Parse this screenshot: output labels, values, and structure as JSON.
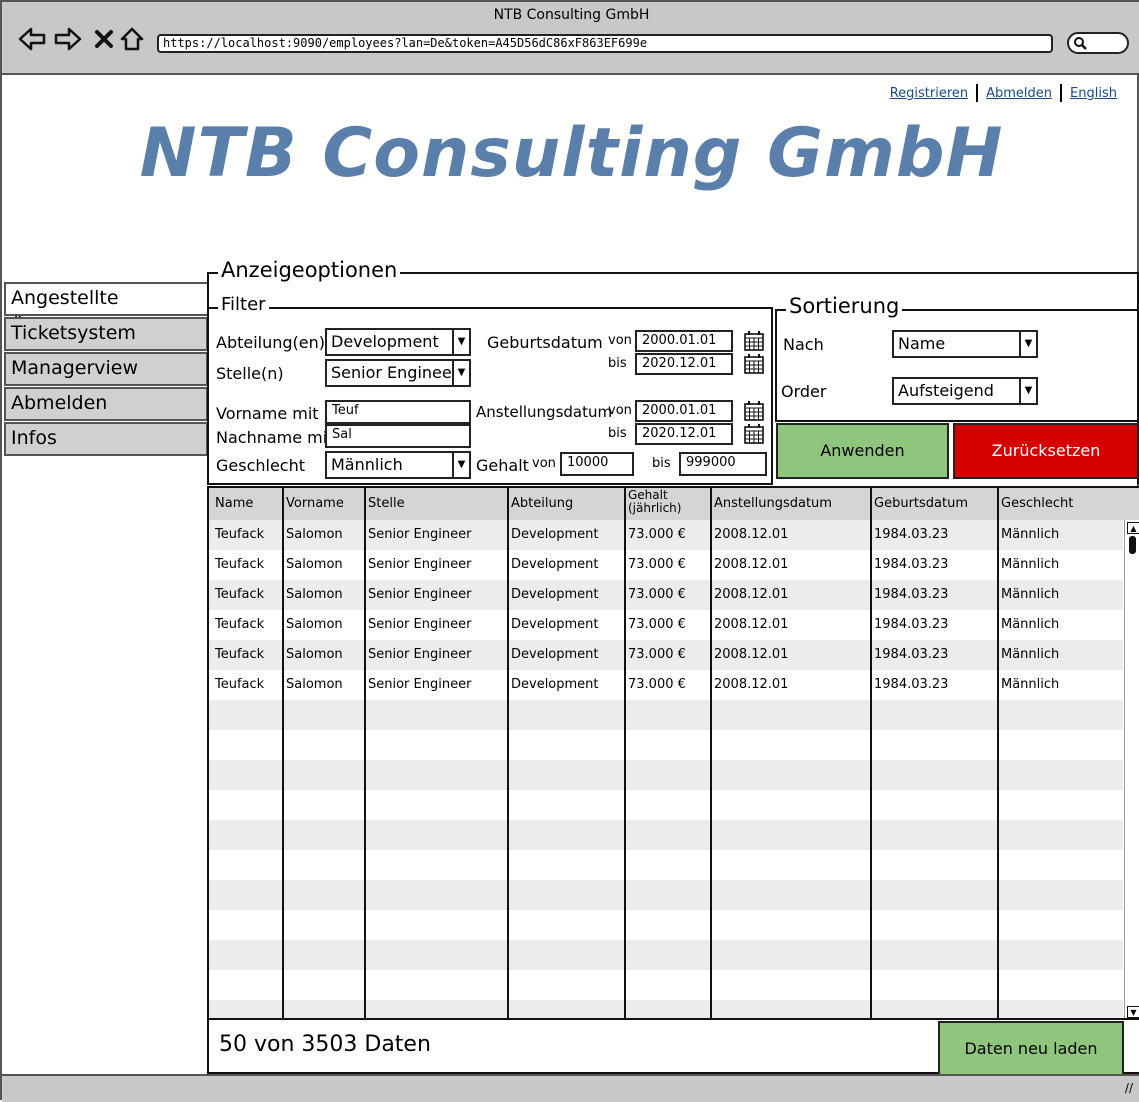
{
  "window": {
    "title": "NTB Consulting GmbH",
    "url": "https://localhost:9090/employees?lan=De&token=A45D56dC86xF863EF699e",
    "nav_icons": [
      "back-icon",
      "forward-icon",
      "stop-icon",
      "home-icon"
    ],
    "search_icon": "search-icon"
  },
  "header": {
    "links": [
      "Registrieren",
      "Abmelden",
      "English"
    ],
    "logo": "NTB Consulting GmbH",
    "logo_color": "#5a7fab"
  },
  "sidebar": {
    "items": [
      {
        "label": "Angestellte Übersicht",
        "active": true
      },
      {
        "label": "Ticketsystem",
        "active": false
      },
      {
        "label": "Managerview",
        "active": false
      },
      {
        "label": "Abmelden",
        "active": false
      },
      {
        "label": "Infos",
        "active": false
      }
    ]
  },
  "options": {
    "title": "Anzeigeoptionen",
    "filter": {
      "title": "Filter",
      "department_label": "Abteilung(en)",
      "department_value": "Development",
      "position_label": "Stelle(n)",
      "position_value": "Senior Engineer",
      "firstname_label": "Vorname mit",
      "firstname_value": "Teuf",
      "lastname_label": "Nachname mit",
      "lastname_value": "Sal",
      "gender_label": "Geschlecht",
      "gender_value": "Männlich",
      "birth_label": "Geburtsdatum",
      "from": "von",
      "to": "bis",
      "birth_from": "2000.01.01",
      "birth_to": "2020.12.01",
      "hire_label": "Anstellungsdatum",
      "hire_from": "2000.01.01",
      "hire_to": "2020.12.01",
      "salary_label": "Gehalt",
      "salary_from": "10000",
      "salary_to": "999000"
    },
    "sort": {
      "title": "Sortierung",
      "by_label": "Nach",
      "by_value": "Name",
      "order_label": "Order",
      "order_value": "Aufsteigend"
    },
    "apply_label": "Anwenden",
    "reset_label": "Zurücksetzen",
    "apply_color": "#8fc67d",
    "reset_color": "#d40000"
  },
  "table": {
    "columns": [
      "Name",
      "Vorname",
      "Stelle",
      "Abteilung",
      "Gehalt (jährlich)",
      "Anstellungsdatum",
      "Geburtsdatum",
      "Geschlecht"
    ],
    "rows": [
      [
        "Teufack",
        "Salomon",
        "Senior Engineer",
        "Development",
        "73.000 €",
        "2008.12.01",
        "1984.03.23",
        "Männlich"
      ],
      [
        "Teufack",
        "Salomon",
        "Senior Engineer",
        "Development",
        "73.000 €",
        "2008.12.01",
        "1984.03.23",
        "Männlich"
      ],
      [
        "Teufack",
        "Salomon",
        "Senior Engineer",
        "Development",
        "73.000 €",
        "2008.12.01",
        "1984.03.23",
        "Männlich"
      ],
      [
        "Teufack",
        "Salomon",
        "Senior Engineer",
        "Development",
        "73.000 €",
        "2008.12.01",
        "1984.03.23",
        "Männlich"
      ],
      [
        "Teufack",
        "Salomon",
        "Senior Engineer",
        "Development",
        "73.000 €",
        "2008.12.01",
        "1984.03.23",
        "Männlich"
      ],
      [
        "Teufack",
        "Salomon",
        "Senior Engineer",
        "Development",
        "73.000 €",
        "2008.12.01",
        "1984.03.23",
        "Männlich"
      ]
    ]
  },
  "footer": {
    "count_text": "50 von 3503 Daten",
    "reload_label": "Daten neu laden"
  }
}
